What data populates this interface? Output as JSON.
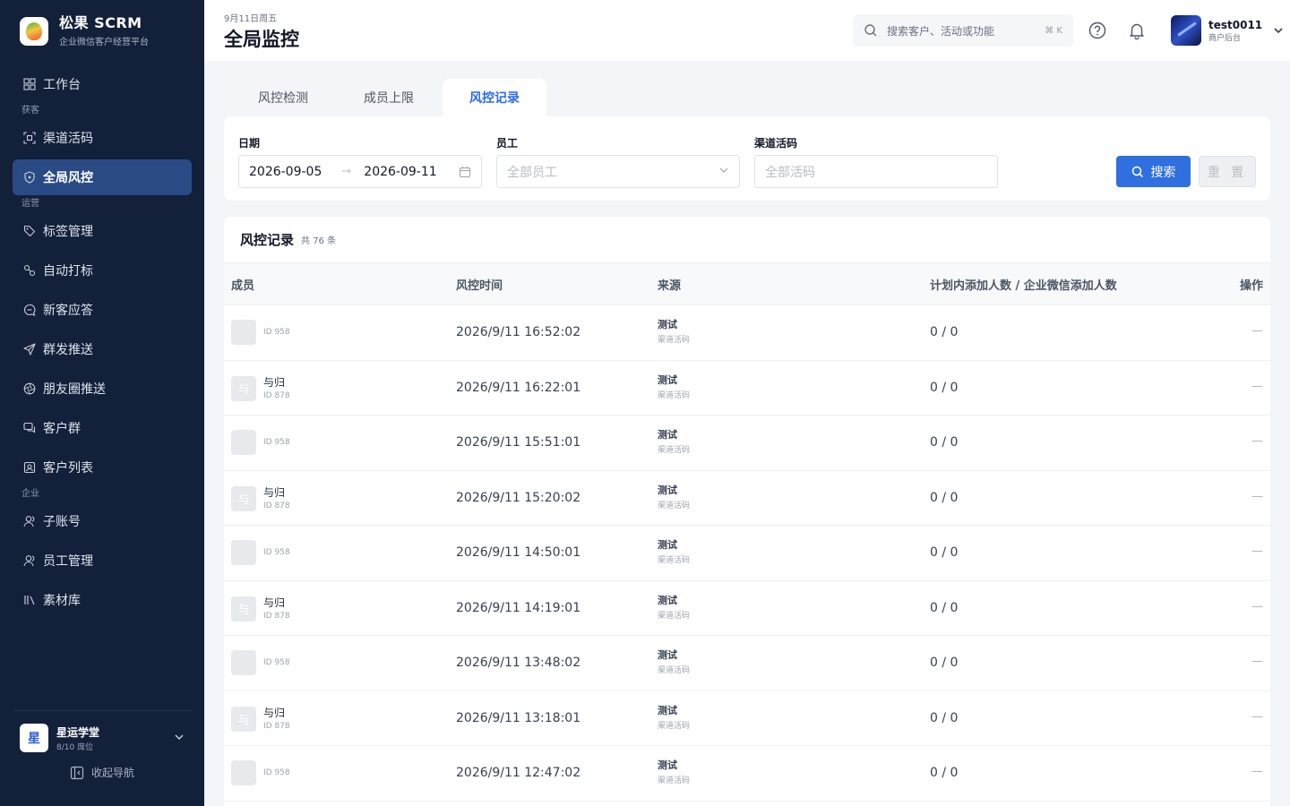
{
  "brand": {
    "title": "松果 SCRM",
    "subtitle": "企业微信客户经营平台"
  },
  "sidebar": {
    "items": [
      {
        "type": "item",
        "label": "工作台",
        "icon": "grid-icon",
        "active": false
      },
      {
        "type": "group",
        "label": "获客"
      },
      {
        "type": "item",
        "label": "渠道活码",
        "icon": "scan-icon",
        "active": false
      },
      {
        "type": "item",
        "label": "全局风控",
        "icon": "shield-icon",
        "active": true
      },
      {
        "type": "group",
        "label": "运营"
      },
      {
        "type": "item",
        "label": "标签管理",
        "icon": "tag-icon",
        "active": false
      },
      {
        "type": "item",
        "label": "自动打标",
        "icon": "link-icon",
        "active": false
      },
      {
        "type": "item",
        "label": "新客应答",
        "icon": "chat-icon",
        "active": false
      },
      {
        "type": "item",
        "label": "群发推送",
        "icon": "send-icon",
        "active": false
      },
      {
        "type": "item",
        "label": "朋友圈推送",
        "icon": "aperture-icon",
        "active": false
      },
      {
        "type": "item",
        "label": "客户群",
        "icon": "group-chat-icon",
        "active": false
      },
      {
        "type": "item",
        "label": "客户列表",
        "icon": "contact-icon",
        "active": false
      },
      {
        "type": "group",
        "label": "企业"
      },
      {
        "type": "item",
        "label": "子账号",
        "icon": "user-icon",
        "active": false
      },
      {
        "type": "item",
        "label": "员工管理",
        "icon": "user-icon",
        "active": false
      },
      {
        "type": "item",
        "label": "素材库",
        "icon": "library-icon",
        "active": false
      }
    ],
    "org": {
      "avatar": "星",
      "name": "星运学堂",
      "seats": "8/10 席位"
    },
    "collapse_label": "收起导航"
  },
  "header": {
    "date": "9月11日周五",
    "title": "全局监控",
    "search_placeholder": "搜索客户、活动或功能",
    "search_shortcut": "⌘ K",
    "user": {
      "name": "test0011",
      "role": "商户后台"
    }
  },
  "tabs": [
    {
      "label": "风控检测",
      "active": false
    },
    {
      "label": "成员上限",
      "active": false
    },
    {
      "label": "风控记录",
      "active": true
    }
  ],
  "filters": {
    "date_label": "日期",
    "date_start": "2026-09-05",
    "date_end": "2026-09-11",
    "employee_label": "员工",
    "employee_placeholder": "全部员工",
    "channel_label": "渠道活码",
    "channel_placeholder": "全部活码",
    "search_button": "搜索",
    "reset_button": "重 置"
  },
  "records": {
    "title": "风控记录",
    "count": "共 76 条",
    "columns": [
      "成员",
      "风控时间",
      "来源",
      "计划内添加人数 / 企业微信添加人数",
      "操作"
    ],
    "rows": [
      {
        "avatar": "",
        "name": "",
        "id": "ID 958",
        "time": "2026/9/11 16:52:02",
        "source": "测试",
        "source_type": "渠道活码",
        "count": "0 / 0",
        "op": "—"
      },
      {
        "avatar": "与",
        "name": "与归",
        "id": "ID 878",
        "time": "2026/9/11 16:22:01",
        "source": "测试",
        "source_type": "渠道活码",
        "count": "0 / 0",
        "op": "—"
      },
      {
        "avatar": "",
        "name": "",
        "id": "ID 958",
        "time": "2026/9/11 15:51:01",
        "source": "测试",
        "source_type": "渠道活码",
        "count": "0 / 0",
        "op": "—"
      },
      {
        "avatar": "与",
        "name": "与归",
        "id": "ID 878",
        "time": "2026/9/11 15:20:02",
        "source": "测试",
        "source_type": "渠道活码",
        "count": "0 / 0",
        "op": "—"
      },
      {
        "avatar": "",
        "name": "",
        "id": "ID 958",
        "time": "2026/9/11 14:50:01",
        "source": "测试",
        "source_type": "渠道活码",
        "count": "0 / 0",
        "op": "—"
      },
      {
        "avatar": "与",
        "name": "与归",
        "id": "ID 878",
        "time": "2026/9/11 14:19:01",
        "source": "测试",
        "source_type": "渠道活码",
        "count": "0 / 0",
        "op": "—"
      },
      {
        "avatar": "",
        "name": "",
        "id": "ID 958",
        "time": "2026/9/11 13:48:02",
        "source": "测试",
        "source_type": "渠道活码",
        "count": "0 / 0",
        "op": "—"
      },
      {
        "avatar": "与",
        "name": "与归",
        "id": "ID 878",
        "time": "2026/9/11 13:18:01",
        "source": "测试",
        "source_type": "渠道活码",
        "count": "0 / 0",
        "op": "—"
      },
      {
        "avatar": "",
        "name": "",
        "id": "ID 958",
        "time": "2026/9/11 12:47:02",
        "source": "测试",
        "source_type": "渠道活码",
        "count": "0 / 0",
        "op": "—"
      }
    ]
  }
}
